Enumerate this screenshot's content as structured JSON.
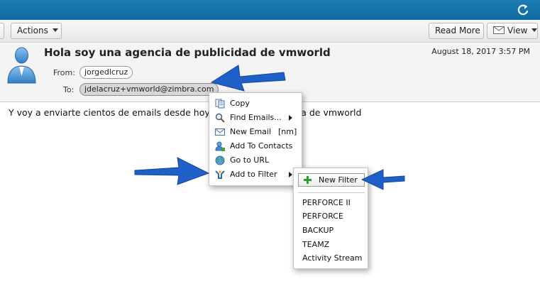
{
  "toolbar": {
    "actions_label": "Actions",
    "read_more_label": "Read More",
    "view_label": "View"
  },
  "message": {
    "subject": "Hola soy una agencia de publicidad de vmworld",
    "date": "August 18, 2017 3:57 PM",
    "from_label": "From:",
    "from_value": "jorgedlcruz",
    "to_label": "To:",
    "to_value": "jdelacruz+vmworld@zimbra.com",
    "body": "Y voy a enviarte cientos de emails desde hoy mismo con tu cuenta de vmworld"
  },
  "context_menu": {
    "items": [
      {
        "label": "Copy",
        "icon": "copy-icon"
      },
      {
        "label": "Find Emails...",
        "icon": "search-icon",
        "has_submenu": true
      },
      {
        "label": "New Email",
        "icon": "new-email-icon",
        "shortcut": "[nm]"
      },
      {
        "label": "Add To Contacts",
        "icon": "add-contact-icon"
      },
      {
        "label": "Go to URL",
        "icon": "globe-icon"
      },
      {
        "label": "Add to Filter",
        "icon": "filter-icon",
        "has_submenu": true
      }
    ]
  },
  "filter_submenu": {
    "new_filter_label": "New Filter",
    "filters": [
      "PERFORCE II",
      "PERFORCE",
      "BACKUP",
      "TEAMZ",
      "Activity Stream"
    ]
  },
  "colors": {
    "topbar": "#1474ab",
    "annotation_arrow": "#1f5fc8"
  }
}
